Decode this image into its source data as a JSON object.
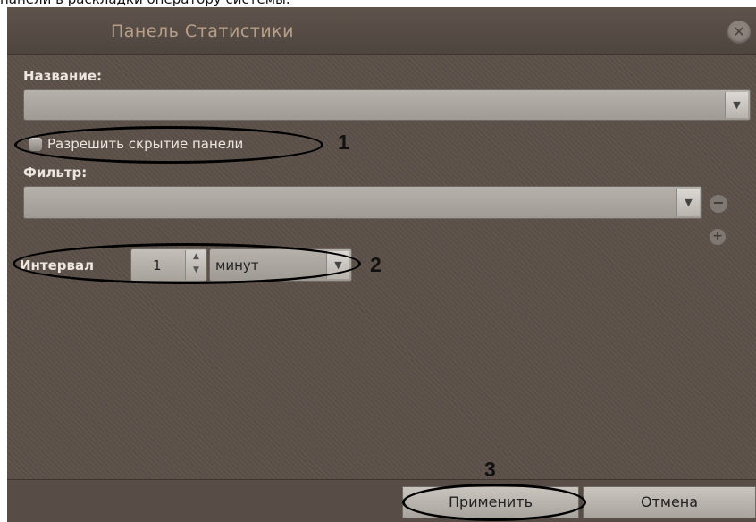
{
  "caption": "панели в раскладки оператору системы.",
  "window": {
    "title": "Панель Статистики",
    "close_icon": "close-icon"
  },
  "name_field": {
    "label": "Название:",
    "value": ""
  },
  "hide_panel": {
    "label": "Разрешить скрытие панели",
    "checked": false
  },
  "filter_field": {
    "label": "Фильтр:",
    "value": ""
  },
  "interval": {
    "label": "Интервал",
    "value": "1",
    "unit": "минут"
  },
  "buttons": {
    "apply": "Применить",
    "cancel": "Отмена"
  },
  "annotations": {
    "one": "1",
    "two": "2",
    "three": "3"
  },
  "colors": {
    "panel_bg": "#5c5149",
    "title_text": "#b79f8a",
    "label_text": "#ece6df"
  }
}
